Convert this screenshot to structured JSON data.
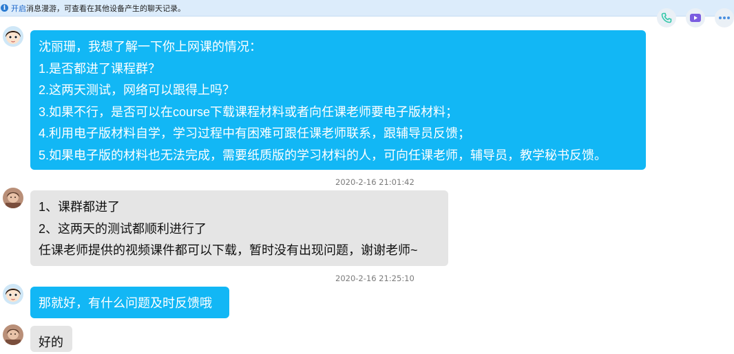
{
  "notice": {
    "link_text": "开启",
    "rest_text": "消息漫游，可查看在其他设备产生的聊天记录。"
  },
  "toolbar": {
    "icons": [
      "phone-icon",
      "video-call-icon",
      "more-icon"
    ],
    "accent": "#12b7f5"
  },
  "messages": [
    {
      "sender": "teacher",
      "lines": [
        "沈丽珊，我想了解一下你上网课的情况：",
        "1.是否都进了课程群？",
        "2.这两天测试，网络可以跟得上吗？",
        "3.如果不行，是否可以在course下载课程材料或者向任课老师要电子版材料；",
        "4.利用电子版材料自学，学习过程中有困难可跟任课老师联系，跟辅导员反馈；",
        "5.如果电子版的材料也无法完成，需要纸质版的学习材料的人，可向任课老师，辅导员，教学秘书反馈。"
      ]
    },
    {
      "timestamp": "2020-2-16 21:01:42"
    },
    {
      "sender": "student",
      "lines": [
        "1、课群都进了",
        "2、这两天的测试都顺利进行了",
        "任课老师提供的视频课件都可以下载，暂时没有出现问题，谢谢老师~"
      ]
    },
    {
      "timestamp": "2020-2-16 21:25:10"
    },
    {
      "sender": "teacher",
      "lines": [
        "那就好，有什么问题及时反馈哦"
      ]
    },
    {
      "sender": "student",
      "lines": [
        "好的"
      ]
    }
  ]
}
